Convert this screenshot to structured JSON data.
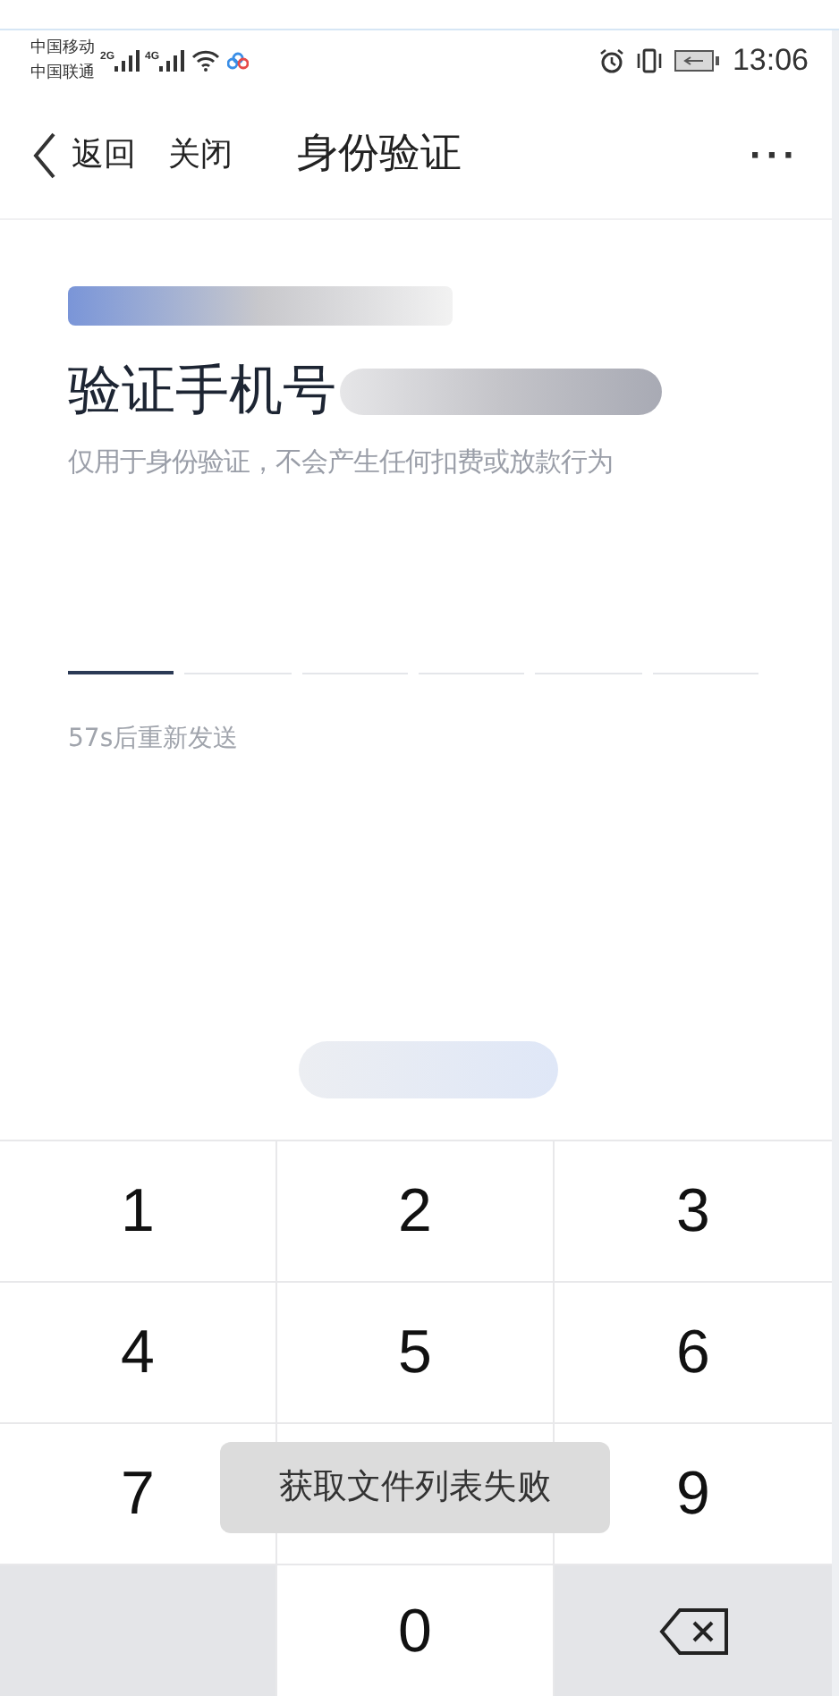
{
  "status_bar": {
    "carriers": [
      "中国移动",
      "中国联通"
    ],
    "network_labels": [
      "2G",
      "4G"
    ],
    "time": "13:06"
  },
  "nav": {
    "back": "返回",
    "close": "关闭",
    "title": "身份验证",
    "more": "···"
  },
  "heading": "验证手机号",
  "subtitle": "仅用于身份验证，不会产生任何扣费或放款行为",
  "code_slots": [
    {
      "selected": true
    },
    {
      "selected": false
    },
    {
      "selected": false
    },
    {
      "selected": false
    },
    {
      "selected": false
    },
    {
      "selected": false
    }
  ],
  "resend": "57s后重新发送",
  "keypad": [
    {
      "kind": "digit",
      "label": "1"
    },
    {
      "kind": "digit",
      "label": "2"
    },
    {
      "kind": "digit",
      "label": "3"
    },
    {
      "kind": "digit",
      "label": "4"
    },
    {
      "kind": "digit",
      "label": "5"
    },
    {
      "kind": "digit",
      "label": "6"
    },
    {
      "kind": "digit",
      "label": "7"
    },
    {
      "kind": "hidden"
    },
    {
      "kind": "digit",
      "label": "9"
    },
    {
      "kind": "blank"
    },
    {
      "kind": "digit",
      "label": "0"
    },
    {
      "kind": "backspace"
    }
  ],
  "toast": "获取文件列表失败"
}
